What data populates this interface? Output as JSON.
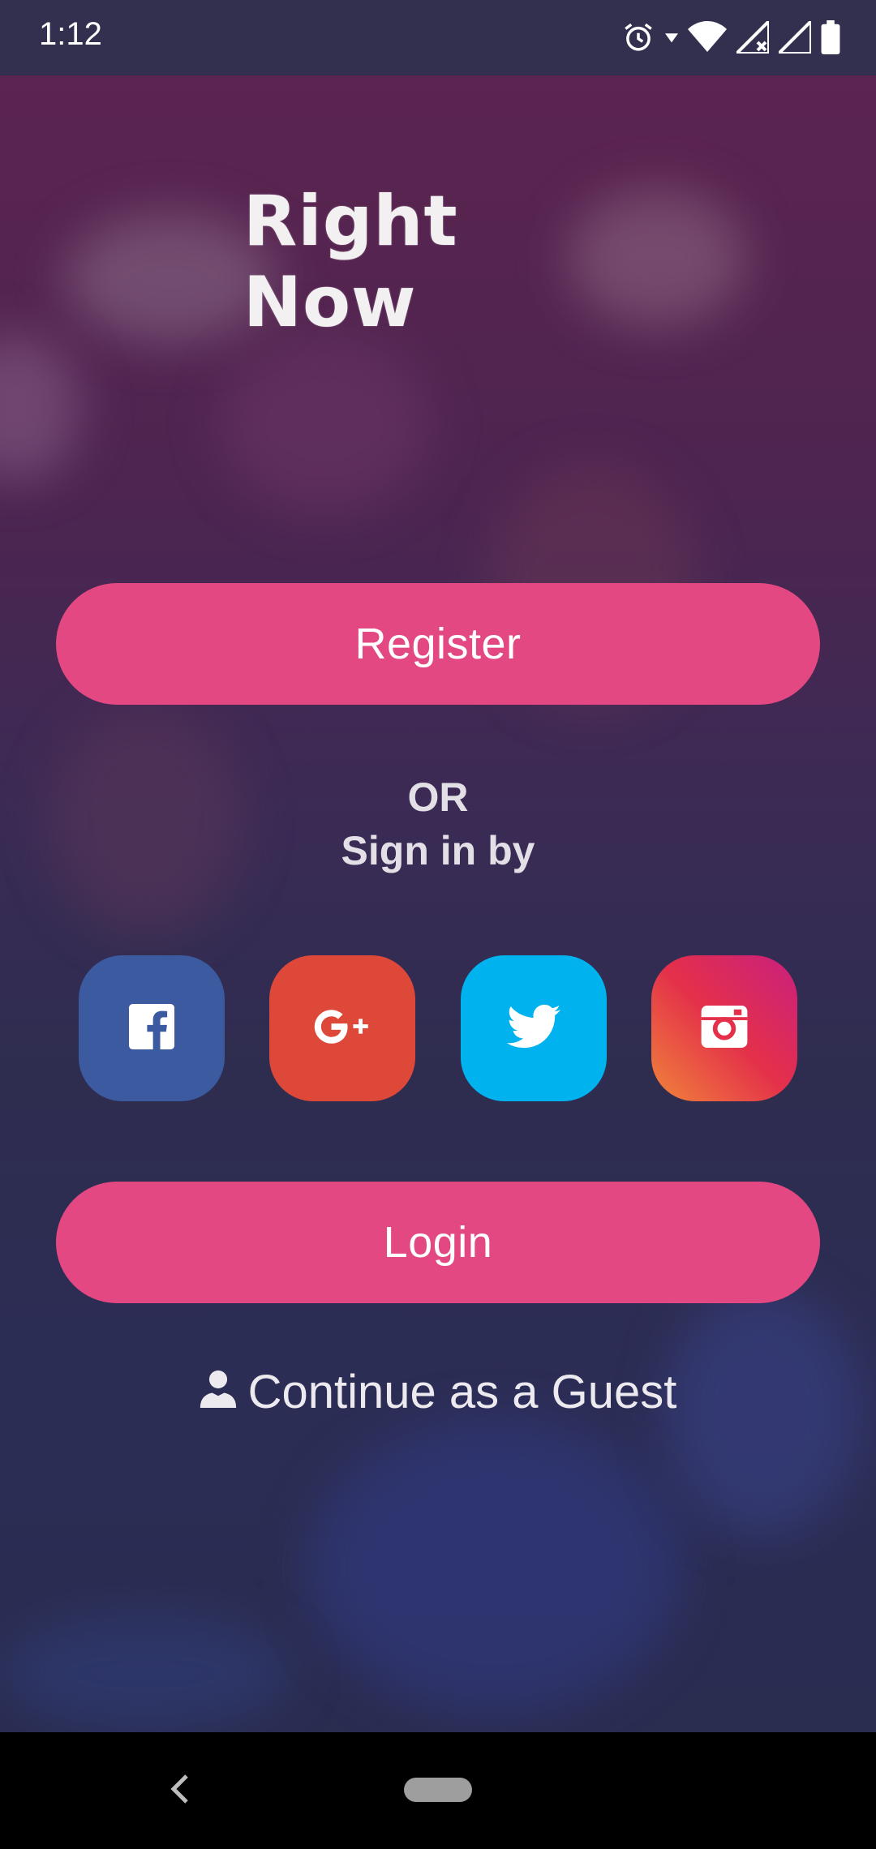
{
  "status_bar": {
    "time": "1:12",
    "icons": [
      "alarm-icon",
      "wifi-icon",
      "signal-icon",
      "signal-icon",
      "battery-icon"
    ],
    "wifi_badge": "4"
  },
  "logo": {
    "text": "Right Now"
  },
  "buttons": {
    "register_label": "Register",
    "login_label": "Login"
  },
  "divider": {
    "or_label": "OR",
    "sign_in_label": "Sign in by"
  },
  "social": [
    {
      "name": "facebook",
      "color": "#3b5aa0",
      "icon": "facebook-icon"
    },
    {
      "name": "google-plus",
      "color": "#dd4839",
      "icon": "google-plus-icon"
    },
    {
      "name": "twitter",
      "color": "#00b3ee",
      "icon": "twitter-icon"
    },
    {
      "name": "instagram",
      "color": "#e4304a",
      "icon": "instagram-icon"
    }
  ],
  "guest": {
    "label": "Continue as a Guest",
    "icon": "person-icon"
  },
  "colors": {
    "accent": "#e44883",
    "background": "#2c2a4a"
  },
  "nav_bar": {
    "icons": [
      "back-icon",
      "home-pill"
    ]
  }
}
